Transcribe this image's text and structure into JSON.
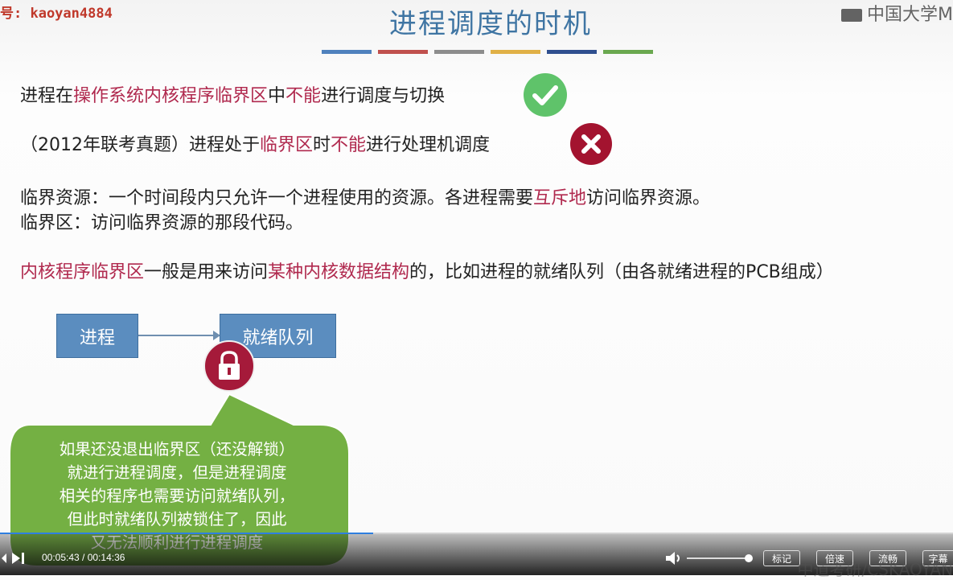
{
  "watermark": "号: kaoyan4884",
  "uni_logo": "中国大学M",
  "title": "进程调度的时机",
  "title_bar_colors": [
    "#4f81bd",
    "#c0504d",
    "#8c8c8c",
    "#e0b046",
    "#2f4f8f",
    "#6aa84f"
  ],
  "line1": {
    "a": "进程在",
    "b": "操作系统内核程序临界区",
    "c": "中",
    "d": "不能",
    "e": "进行调度与切换"
  },
  "line2": {
    "a": "（2012年联考真题）进程处于",
    "b": "临界区",
    "c": "时",
    "d": "不能",
    "e": "进行处理机调度"
  },
  "line3": {
    "a": "临界资源：一个时间段内只允许一个进程使用的资源。各进程需要",
    "b": "互斥地",
    "c": "访问临界资源。"
  },
  "line4": "临界区：访问临界资源的那段代码。",
  "line5": {
    "a": "内核程序临界区",
    "b": "一般是用来访问",
    "c": "某种内核数据结构",
    "d": "的，比如进程的就绪队列（由各就绪进程的PCB组成）"
  },
  "diagram": {
    "process": "进程",
    "ready_queue": "就绪队列"
  },
  "bubble": [
    "如果还没退出临界区（还没解锁）",
    "就进行进程调度，但是进程调度",
    "相关的程序也需要访问就绪队列，",
    "但此时就绪队列被锁住了，因此",
    "又无法顺利进行进程调度"
  ],
  "player": {
    "time": "00:05:43 / 00:14:36",
    "progress_fraction": 0.3915,
    "volume_fraction": 0.95,
    "buttons": {
      "mark": "标记",
      "speed": "倍速",
      "quality": "流畅",
      "subtitle": "字幕"
    }
  },
  "bottom_logo": "中道考研/CSKAOYAN"
}
